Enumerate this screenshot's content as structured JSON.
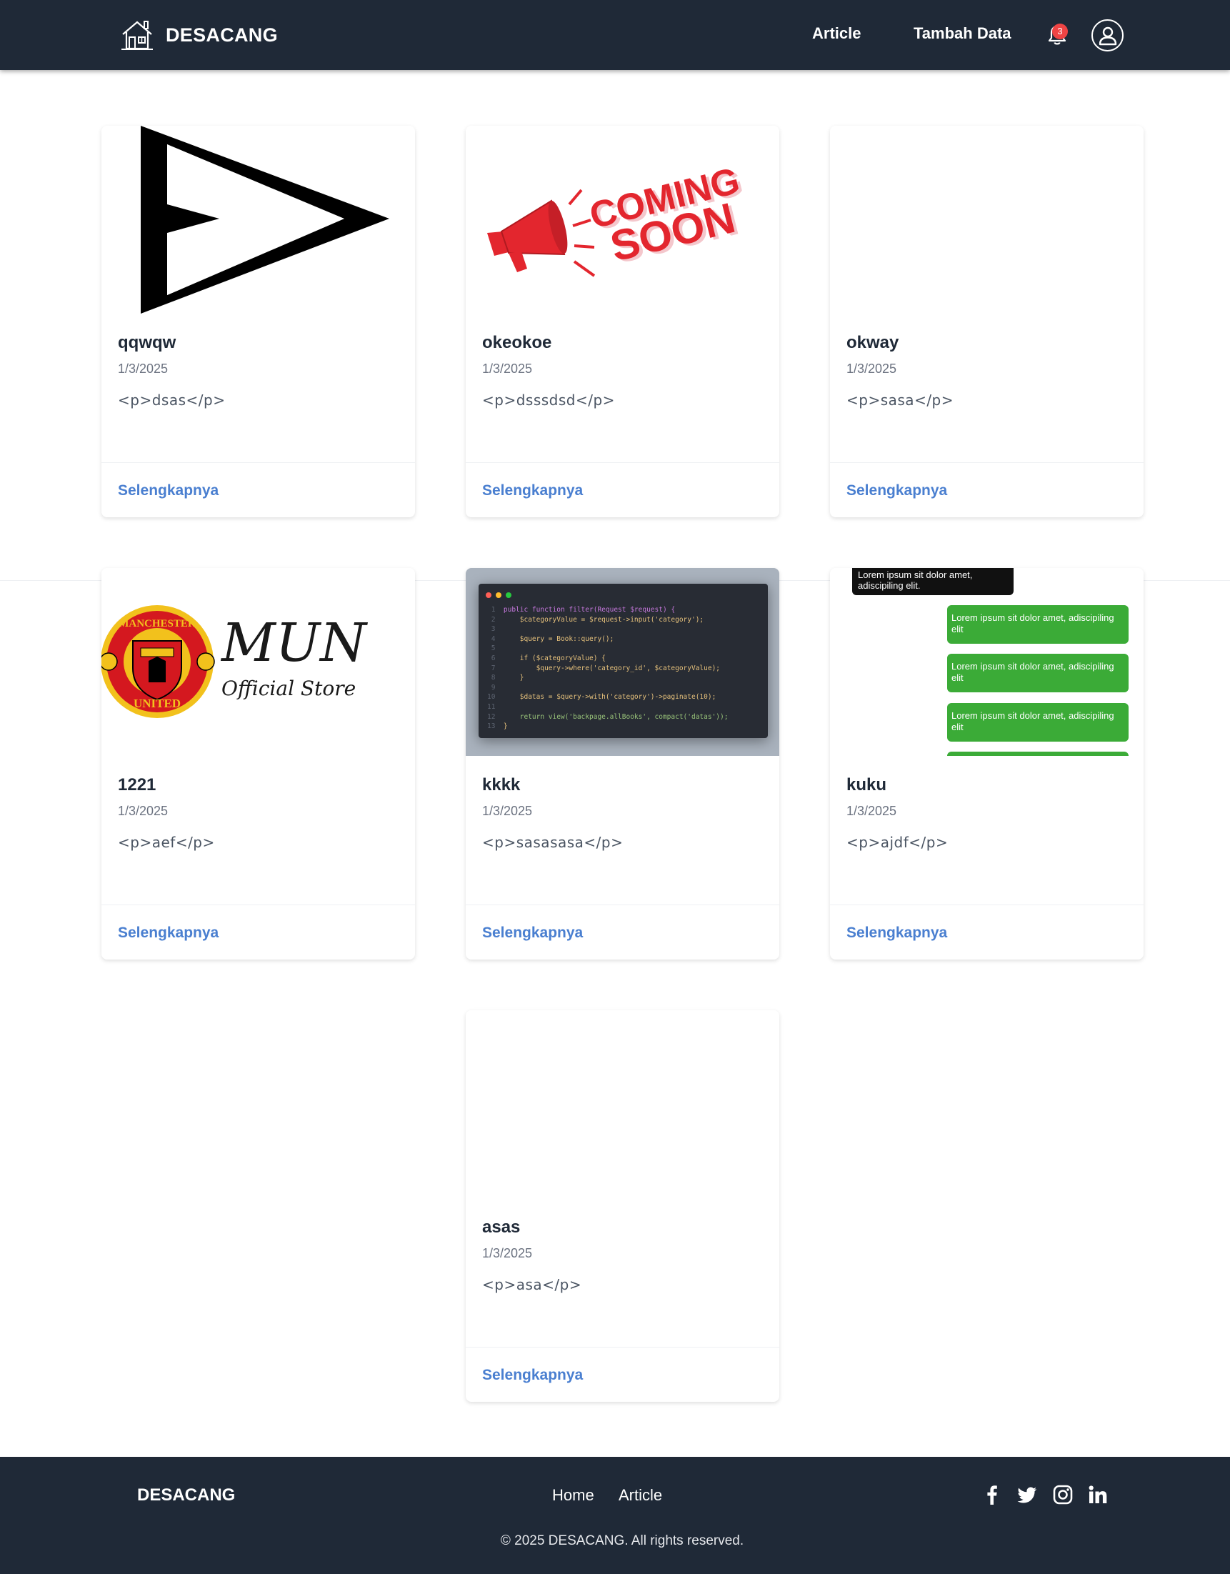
{
  "navbar": {
    "brand": "DESACANG",
    "links": [
      "Article",
      "Tambah Data"
    ],
    "notification_count": "3"
  },
  "cards": [
    {
      "title": "qqwqw",
      "date": "1/3/2025",
      "desc": "<p>dsas</p>",
      "link": "Selengkapnya",
      "image": "play-triangle-icon"
    },
    {
      "title": "okeokoe",
      "date": "1/3/2025",
      "desc": "<p>dsssdsd</p>",
      "link": "Selengkapnya",
      "image": "coming-soon-megaphone"
    },
    {
      "title": "okway",
      "date": "1/3/2025",
      "desc": "<p>sasa</p>",
      "link": "Selengkapnya",
      "image": "blank"
    },
    {
      "title": "1221",
      "date": "1/3/2025",
      "desc": "<p>aef</p>",
      "link": "Selengkapnya",
      "image": "manchester-united-logo"
    },
    {
      "title": "kkkk",
      "date": "1/3/2025",
      "desc": "<p>sasasasa</p>",
      "link": "Selengkapnya",
      "image": "code-editor-screenshot"
    },
    {
      "title": "kuku",
      "date": "1/3/2025",
      "desc": "<p>ajdf</p>",
      "link": "Selengkapnya",
      "image": "chat-bubbles-screenshot"
    },
    {
      "title": "asas",
      "date": "1/3/2025",
      "desc": "<p>asa</p>",
      "link": "Selengkapnya",
      "image": "blank"
    }
  ],
  "images": {
    "coming_soon": [
      "COMING",
      "SOON"
    ],
    "mun": {
      "title": "MUN",
      "subtitle": "Official Store",
      "crest_top": "MANCHESTER",
      "crest_bottom": "UNITED"
    },
    "code_lines": [
      "public function filter(Request $request) {",
      "    $categoryValue = $request->input('category');",
      "",
      "    $query = Book::query();",
      "",
      "    if ($categoryValue) {",
      "        $query->where('category_id', $categoryValue);",
      "    }",
      "",
      "    $datas = $query->with('category')->paginate(10);",
      "",
      "    return view('backpage.allBooks', compact('datas'));",
      "}"
    ],
    "chat_dark": "Lorem ipsum sit dolor amet, adiscipiling elit.",
    "chat_green": "Lorem ipsum sit dolor amet, adiscipiling elit"
  },
  "footer": {
    "brand": "DESACANG",
    "links": [
      "Home",
      "Article"
    ],
    "social": [
      "facebook-icon",
      "twitter-icon",
      "instagram-icon",
      "linkedin-icon"
    ],
    "copyright": "© 2025 DESACANG. All rights reserved."
  },
  "colors": {
    "navbar_bg": "#1f2937",
    "link_blue": "#4a7fd0",
    "badge_red": "#ef4444",
    "chat_green": "#3bab37"
  }
}
